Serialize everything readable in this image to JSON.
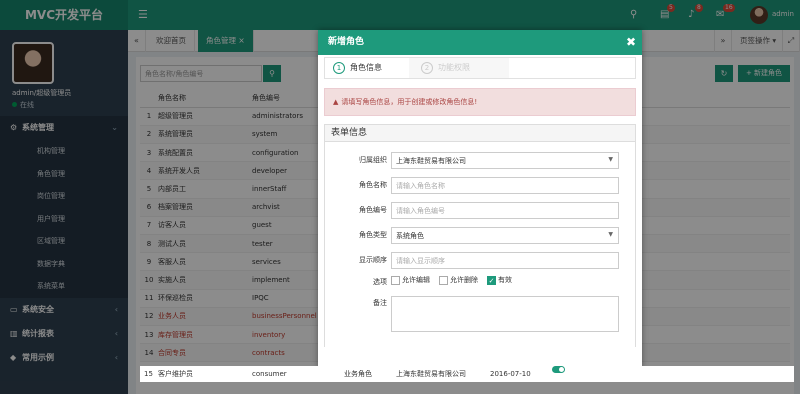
{
  "app": {
    "title": "MVC开发平台"
  },
  "top": {
    "badges": {
      "tasks": "5",
      "notifications": "8",
      "messages": "16"
    },
    "username": "admin"
  },
  "user": {
    "name": "admin/超级管理员",
    "status": "在线"
  },
  "sidebar": {
    "sections": [
      {
        "label": "系统管理",
        "icon": "gears-icon",
        "items": [
          "机构管理",
          "角色管理",
          "岗位管理",
          "用户管理",
          "区域管理",
          "数据字典",
          "系统菜单"
        ]
      },
      {
        "label": "系统安全",
        "icon": "monitor-icon"
      },
      {
        "label": "统计报表",
        "icon": "bar-chart-icon"
      },
      {
        "label": "常用示例",
        "icon": "tag-icon"
      }
    ]
  },
  "tabs": [
    {
      "label": "欢迎首页"
    },
    {
      "label": "角色管理"
    }
  ],
  "tab_ops": "页签操作",
  "toolbar": {
    "search_placeholder": "角色名称/角色编号",
    "new_label": "新建角色"
  },
  "table": {
    "headers": [
      "",
      "角色名称",
      "角色编号"
    ],
    "rows": [
      [
        "1",
        "超级管理员",
        "administrators"
      ],
      [
        "2",
        "系统管理员",
        "system"
      ],
      [
        "3",
        "系统配置员",
        "configuration"
      ],
      [
        "4",
        "系统开发人员",
        "developer"
      ],
      [
        "5",
        "内部员工",
        "innerStaff"
      ],
      [
        "6",
        "档案管理员",
        "archvist"
      ],
      [
        "7",
        "访客人员",
        "guest"
      ],
      [
        "8",
        "测试人员",
        "tester"
      ],
      [
        "9",
        "客服人员",
        "services"
      ],
      [
        "10",
        "实施人员",
        "implement"
      ],
      [
        "11",
        "环保巡检员",
        "IPQC"
      ],
      [
        "12",
        "业务人员",
        "businessPersonnel"
      ],
      [
        "13",
        "库存管理员",
        "inventory"
      ],
      [
        "14",
        "合同专员",
        "contracts"
      ]
    ],
    "last_row": [
      "15",
      "客户维护员",
      "consumer",
      "业务角色",
      "上海东鞋贸易有限公司",
      "2016-07-10"
    ]
  },
  "modal": {
    "title": "新增角色",
    "steps": [
      {
        "num": "1",
        "label": "角色信息"
      },
      {
        "num": "2",
        "label": "功能权限"
      }
    ],
    "alert": "请填写角色信息，用于创建或修改角色信息!",
    "panel_title": "表单信息",
    "fields": {
      "org_label": "归属组织",
      "org_value": "上海东鞋贸易有限公司",
      "name_label": "角色名称",
      "name_placeholder": "请输入角色名称",
      "code_label": "角色编号",
      "code_placeholder": "请输入角色编号",
      "type_label": "角色类型",
      "type_value": "系统角色",
      "order_label": "显示顺序",
      "order_placeholder": "请输入显示顺序",
      "options_label": "选项",
      "options": [
        {
          "label": "允许编辑",
          "checked": false
        },
        {
          "label": "允许删除",
          "checked": false
        },
        {
          "label": "有效",
          "checked": true
        }
      ],
      "remark_label": "备注"
    }
  },
  "colors": {
    "primary": "#1e9a7c",
    "sidebar": "#2f4050",
    "alert_bg": "#f2dede"
  }
}
